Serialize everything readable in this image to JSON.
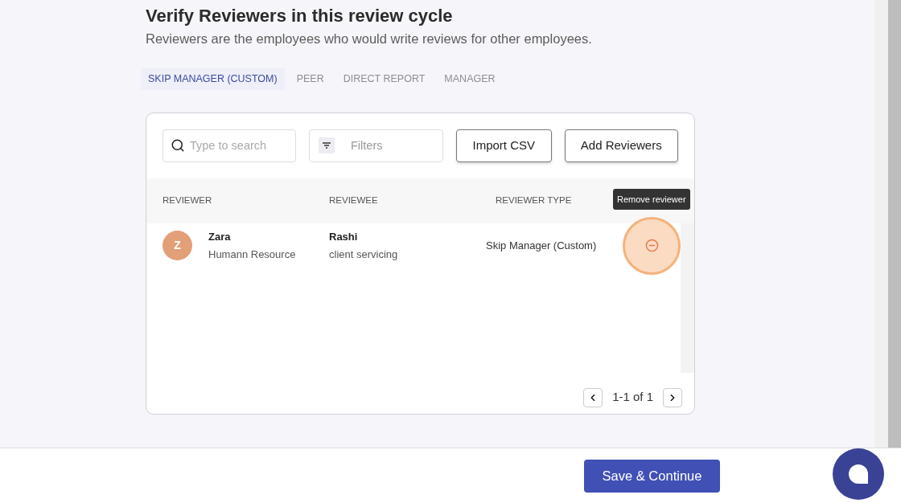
{
  "header": {
    "title": "Verify Reviewers in this review cycle",
    "subtitle": "Reviewers are the employees who would write reviews for other employees."
  },
  "tabs": [
    {
      "label": "SKIP MANAGER (CUSTOM)",
      "selected": true
    },
    {
      "label": "PEER",
      "selected": false
    },
    {
      "label": "DIRECT REPORT",
      "selected": false
    },
    {
      "label": "MANAGER",
      "selected": false
    }
  ],
  "toolbar": {
    "search": {
      "placeholder": "Type to search"
    },
    "filters": {
      "placeholder": "Filters"
    },
    "buttons": [
      "Import CSV",
      "Add Reviewers"
    ]
  },
  "table": {
    "columns": [
      "REVIEWER",
      "REVIEWEE",
      "REVIEWER TYPE"
    ],
    "rows": [
      {
        "reviewer": {
          "initial": "Z",
          "name": "Zara",
          "department": "Humann Resource"
        },
        "reviewee": {
          "name": "Rashi",
          "department": "client servicing"
        },
        "type": "Skip Manager (Custom)",
        "tooltip": "Remove reviewer"
      }
    ]
  },
  "pagination": {
    "range": "1-1 of 1"
  },
  "footer": {
    "button": "Save & Continue"
  }
}
